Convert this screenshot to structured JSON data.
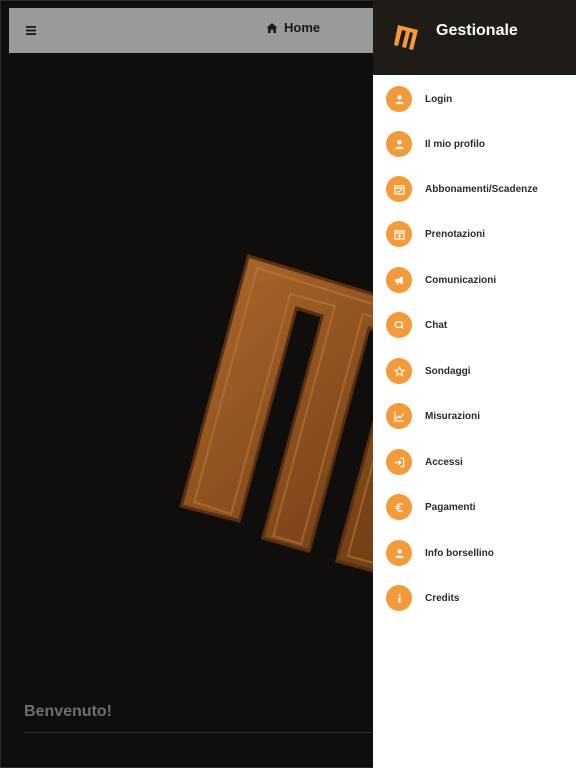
{
  "topbar": {
    "home_label": "Home"
  },
  "main": {
    "welcome_text": "Benvenuto!"
  },
  "drawer": {
    "title": "Gestionale",
    "items": [
      {
        "label": "Login",
        "icon": "user-icon"
      },
      {
        "label": "Il mio profilo",
        "icon": "user-icon"
      },
      {
        "label": "Abbonamenti/Scadenze",
        "icon": "calendar-check-icon"
      },
      {
        "label": "Prenotazioni",
        "icon": "calendar-plus-icon"
      },
      {
        "label": "Comunicazioni",
        "icon": "megaphone-icon"
      },
      {
        "label": "Chat",
        "icon": "chat-icon"
      },
      {
        "label": "Sondaggi",
        "icon": "star-icon"
      },
      {
        "label": "Misurazioni",
        "icon": "chart-icon"
      },
      {
        "label": "Accessi",
        "icon": "sign-in-icon"
      },
      {
        "label": "Pagamenti",
        "icon": "euro-icon"
      },
      {
        "label": "Info borsellino",
        "icon": "user-icon"
      },
      {
        "label": "Credits",
        "icon": "info-icon"
      }
    ]
  },
  "colors": {
    "accent": "#f39b3b",
    "drawer_header": "#1f1c18",
    "topbar": "#9a9a9a",
    "background": "#0f0e0c"
  }
}
